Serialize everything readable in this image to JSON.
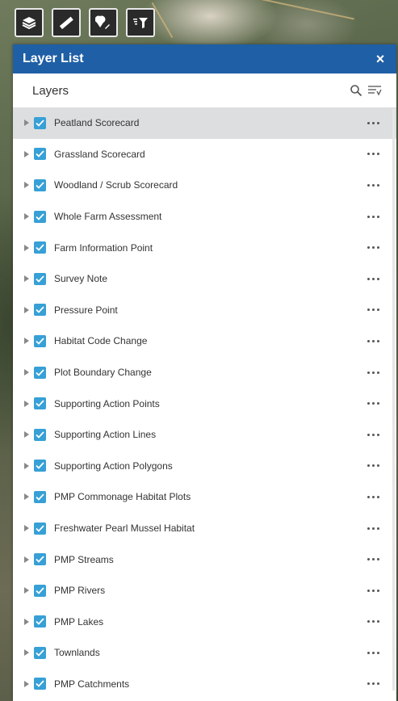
{
  "toolbar": {
    "tools": [
      {
        "name": "layer-list-tool",
        "icon": "layers-icon"
      },
      {
        "name": "measure-tool",
        "icon": "ruler-icon"
      },
      {
        "name": "draw-tool",
        "icon": "pen-marker-icon"
      },
      {
        "name": "filter-tool",
        "icon": "filter-icon"
      }
    ]
  },
  "panel": {
    "title": "Layer List",
    "close_label": "×",
    "layers_label": "Layers"
  },
  "layers": [
    {
      "label": "Peatland Scorecard",
      "checked": true,
      "selected": true
    },
    {
      "label": "Grassland Scorecard",
      "checked": true
    },
    {
      "label": "Woodland / Scrub Scorecard",
      "checked": true
    },
    {
      "label": "Whole Farm Assessment",
      "checked": true
    },
    {
      "label": "Farm Information Point",
      "checked": true
    },
    {
      "label": "Survey Note",
      "checked": true
    },
    {
      "label": "Pressure Point",
      "checked": true
    },
    {
      "label": "Habitat Code Change",
      "checked": true
    },
    {
      "label": "Plot Boundary Change",
      "checked": true
    },
    {
      "label": "Supporting Action Points",
      "checked": true
    },
    {
      "label": "Supporting Action Lines",
      "checked": true
    },
    {
      "label": "Supporting Action Polygons",
      "checked": true
    },
    {
      "label": "PMP Commonage Habitat Plots",
      "checked": true
    },
    {
      "label": "Freshwater Pearl Mussel Habitat",
      "checked": true
    },
    {
      "label": "PMP Streams",
      "checked": true
    },
    {
      "label": "PMP Rivers",
      "checked": true
    },
    {
      "label": "PMP Lakes",
      "checked": true
    },
    {
      "label": "Townlands",
      "checked": true
    },
    {
      "label": "PMP Catchments",
      "checked": true
    }
  ],
  "colors": {
    "header": "#1f5fa5",
    "checkbox": "#37a0d6",
    "selected_row": "#dcdee0"
  }
}
